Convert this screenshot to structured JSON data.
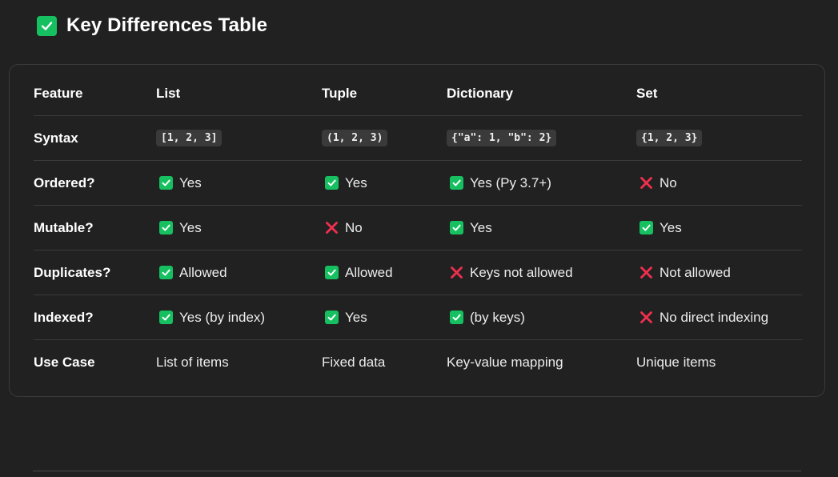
{
  "heading": {
    "title": "Key Differences Table",
    "icon": "check-box-icon"
  },
  "colors": {
    "background": "#212121",
    "check": "#16c060",
    "cross": "#f0304e",
    "code_bg": "#3a3a3a"
  },
  "table": {
    "headers": [
      "Feature",
      "List",
      "Tuple",
      "Dictionary",
      "Set"
    ],
    "rows": [
      {
        "feature": "Syntax",
        "cells": [
          {
            "icon": "none",
            "text": "[1, 2, 3]",
            "code": true
          },
          {
            "icon": "none",
            "text": "(1, 2, 3)",
            "code": true
          },
          {
            "icon": "none",
            "text": "{\"a\": 1, \"b\": 2}",
            "code": true
          },
          {
            "icon": "none",
            "text": "{1, 2, 3}",
            "code": true
          }
        ]
      },
      {
        "feature": "Ordered?",
        "cells": [
          {
            "icon": "check",
            "text": "Yes"
          },
          {
            "icon": "check",
            "text": "Yes"
          },
          {
            "icon": "check",
            "text": "Yes (Py 3.7+)"
          },
          {
            "icon": "cross",
            "text": "No"
          }
        ]
      },
      {
        "feature": "Mutable?",
        "cells": [
          {
            "icon": "check",
            "text": "Yes"
          },
          {
            "icon": "cross",
            "text": "No"
          },
          {
            "icon": "check",
            "text": "Yes"
          },
          {
            "icon": "check",
            "text": "Yes"
          }
        ]
      },
      {
        "feature": "Duplicates?",
        "cells": [
          {
            "icon": "check",
            "text": "Allowed"
          },
          {
            "icon": "check",
            "text": "Allowed"
          },
          {
            "icon": "cross",
            "text": "Keys not allowed"
          },
          {
            "icon": "cross",
            "text": "Not allowed"
          }
        ]
      },
      {
        "feature": "Indexed?",
        "cells": [
          {
            "icon": "check",
            "text": "Yes (by index)"
          },
          {
            "icon": "check",
            "text": "Yes"
          },
          {
            "icon": "check",
            "text": "(by keys)"
          },
          {
            "icon": "cross",
            "text": "No direct indexing"
          }
        ]
      },
      {
        "feature": "Use Case",
        "cells": [
          {
            "icon": "none",
            "text": "List of items"
          },
          {
            "icon": "none",
            "text": "Fixed data"
          },
          {
            "icon": "none",
            "text": "Key-value mapping"
          },
          {
            "icon": "none",
            "text": "Unique items"
          }
        ]
      }
    ]
  }
}
